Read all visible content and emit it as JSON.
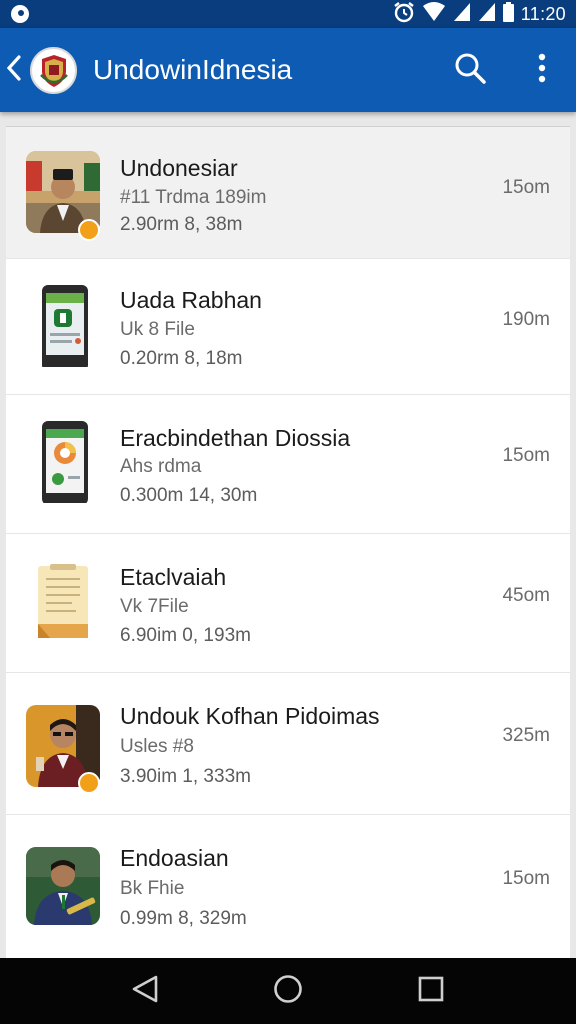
{
  "status_bar": {
    "time": "11:20",
    "icons": [
      "app-notification-icon",
      "alarm-icon",
      "wifi-icon",
      "signal-icon",
      "signal-icon",
      "battery-icon"
    ]
  },
  "app_bar": {
    "title": "UndowinIdnesia",
    "icons": [
      "back-arrow-icon",
      "emblem-logo",
      "search-icon",
      "more-vert-icon"
    ],
    "colors": {
      "primary": "#0e5bb3",
      "status": "#0a3d7e"
    }
  },
  "files": [
    {
      "title": "Undonesiar",
      "subtitle": "#11 Trdma 189im",
      "meta": "2.90rm 8, 38m",
      "size": "15om",
      "thumb": "portrait-photo",
      "badge": true,
      "selected": true
    },
    {
      "title": "Uada Rabhan",
      "subtitle": "Uk 8 File",
      "meta": "0.20rm 8, 18m",
      "size": "190m",
      "thumb": "phone-icon",
      "badge": false,
      "selected": false
    },
    {
      "title": "Eracbindethan Diossia",
      "subtitle": "Ahs rdma",
      "meta": "0.300m 14, 30m",
      "size": "15om",
      "thumb": "phone-chart-icon",
      "badge": false,
      "selected": false
    },
    {
      "title": "Etaclvaiah",
      "subtitle": "Vk 7File",
      "meta": "6.90im 0, 193m",
      "size": "45om",
      "thumb": "notepad-icon",
      "badge": false,
      "selected": false
    },
    {
      "title": "Undouk Kofhan Pidoimas",
      "subtitle": "Usles #8",
      "meta": "3.90im 1, 333m",
      "size": "325m",
      "thumb": "portrait-photo",
      "badge": true,
      "selected": false
    },
    {
      "title": "Endoasian",
      "subtitle": "Bk Fhie",
      "meta": "0.99m 8, 329m",
      "size": "15om",
      "thumb": "portrait-photo",
      "badge": false,
      "selected": false
    }
  ],
  "nav_bar": {
    "icons": [
      "nav-back-icon",
      "nav-home-icon",
      "nav-recents-icon"
    ]
  }
}
